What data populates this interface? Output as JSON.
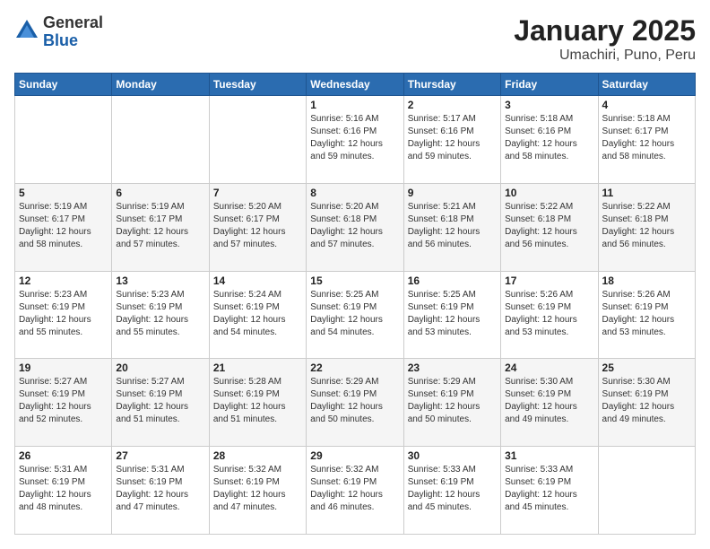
{
  "logo": {
    "general": "General",
    "blue": "Blue"
  },
  "title": "January 2025",
  "subtitle": "Umachiri, Puno, Peru",
  "weekdays": [
    "Sunday",
    "Monday",
    "Tuesday",
    "Wednesday",
    "Thursday",
    "Friday",
    "Saturday"
  ],
  "weeks": [
    [
      {
        "day": "",
        "info": ""
      },
      {
        "day": "",
        "info": ""
      },
      {
        "day": "",
        "info": ""
      },
      {
        "day": "1",
        "info": "Sunrise: 5:16 AM\nSunset: 6:16 PM\nDaylight: 12 hours\nand 59 minutes."
      },
      {
        "day": "2",
        "info": "Sunrise: 5:17 AM\nSunset: 6:16 PM\nDaylight: 12 hours\nand 59 minutes."
      },
      {
        "day": "3",
        "info": "Sunrise: 5:18 AM\nSunset: 6:16 PM\nDaylight: 12 hours\nand 58 minutes."
      },
      {
        "day": "4",
        "info": "Sunrise: 5:18 AM\nSunset: 6:17 PM\nDaylight: 12 hours\nand 58 minutes."
      }
    ],
    [
      {
        "day": "5",
        "info": "Sunrise: 5:19 AM\nSunset: 6:17 PM\nDaylight: 12 hours\nand 58 minutes."
      },
      {
        "day": "6",
        "info": "Sunrise: 5:19 AM\nSunset: 6:17 PM\nDaylight: 12 hours\nand 57 minutes."
      },
      {
        "day": "7",
        "info": "Sunrise: 5:20 AM\nSunset: 6:17 PM\nDaylight: 12 hours\nand 57 minutes."
      },
      {
        "day": "8",
        "info": "Sunrise: 5:20 AM\nSunset: 6:18 PM\nDaylight: 12 hours\nand 57 minutes."
      },
      {
        "day": "9",
        "info": "Sunrise: 5:21 AM\nSunset: 6:18 PM\nDaylight: 12 hours\nand 56 minutes."
      },
      {
        "day": "10",
        "info": "Sunrise: 5:22 AM\nSunset: 6:18 PM\nDaylight: 12 hours\nand 56 minutes."
      },
      {
        "day": "11",
        "info": "Sunrise: 5:22 AM\nSunset: 6:18 PM\nDaylight: 12 hours\nand 56 minutes."
      }
    ],
    [
      {
        "day": "12",
        "info": "Sunrise: 5:23 AM\nSunset: 6:19 PM\nDaylight: 12 hours\nand 55 minutes."
      },
      {
        "day": "13",
        "info": "Sunrise: 5:23 AM\nSunset: 6:19 PM\nDaylight: 12 hours\nand 55 minutes."
      },
      {
        "day": "14",
        "info": "Sunrise: 5:24 AM\nSunset: 6:19 PM\nDaylight: 12 hours\nand 54 minutes."
      },
      {
        "day": "15",
        "info": "Sunrise: 5:25 AM\nSunset: 6:19 PM\nDaylight: 12 hours\nand 54 minutes."
      },
      {
        "day": "16",
        "info": "Sunrise: 5:25 AM\nSunset: 6:19 PM\nDaylight: 12 hours\nand 53 minutes."
      },
      {
        "day": "17",
        "info": "Sunrise: 5:26 AM\nSunset: 6:19 PM\nDaylight: 12 hours\nand 53 minutes."
      },
      {
        "day": "18",
        "info": "Sunrise: 5:26 AM\nSunset: 6:19 PM\nDaylight: 12 hours\nand 53 minutes."
      }
    ],
    [
      {
        "day": "19",
        "info": "Sunrise: 5:27 AM\nSunset: 6:19 PM\nDaylight: 12 hours\nand 52 minutes."
      },
      {
        "day": "20",
        "info": "Sunrise: 5:27 AM\nSunset: 6:19 PM\nDaylight: 12 hours\nand 51 minutes."
      },
      {
        "day": "21",
        "info": "Sunrise: 5:28 AM\nSunset: 6:19 PM\nDaylight: 12 hours\nand 51 minutes."
      },
      {
        "day": "22",
        "info": "Sunrise: 5:29 AM\nSunset: 6:19 PM\nDaylight: 12 hours\nand 50 minutes."
      },
      {
        "day": "23",
        "info": "Sunrise: 5:29 AM\nSunset: 6:19 PM\nDaylight: 12 hours\nand 50 minutes."
      },
      {
        "day": "24",
        "info": "Sunrise: 5:30 AM\nSunset: 6:19 PM\nDaylight: 12 hours\nand 49 minutes."
      },
      {
        "day": "25",
        "info": "Sunrise: 5:30 AM\nSunset: 6:19 PM\nDaylight: 12 hours\nand 49 minutes."
      }
    ],
    [
      {
        "day": "26",
        "info": "Sunrise: 5:31 AM\nSunset: 6:19 PM\nDaylight: 12 hours\nand 48 minutes."
      },
      {
        "day": "27",
        "info": "Sunrise: 5:31 AM\nSunset: 6:19 PM\nDaylight: 12 hours\nand 47 minutes."
      },
      {
        "day": "28",
        "info": "Sunrise: 5:32 AM\nSunset: 6:19 PM\nDaylight: 12 hours\nand 47 minutes."
      },
      {
        "day": "29",
        "info": "Sunrise: 5:32 AM\nSunset: 6:19 PM\nDaylight: 12 hours\nand 46 minutes."
      },
      {
        "day": "30",
        "info": "Sunrise: 5:33 AM\nSunset: 6:19 PM\nDaylight: 12 hours\nand 45 minutes."
      },
      {
        "day": "31",
        "info": "Sunrise: 5:33 AM\nSunset: 6:19 PM\nDaylight: 12 hours\nand 45 minutes."
      },
      {
        "day": "",
        "info": ""
      }
    ]
  ]
}
